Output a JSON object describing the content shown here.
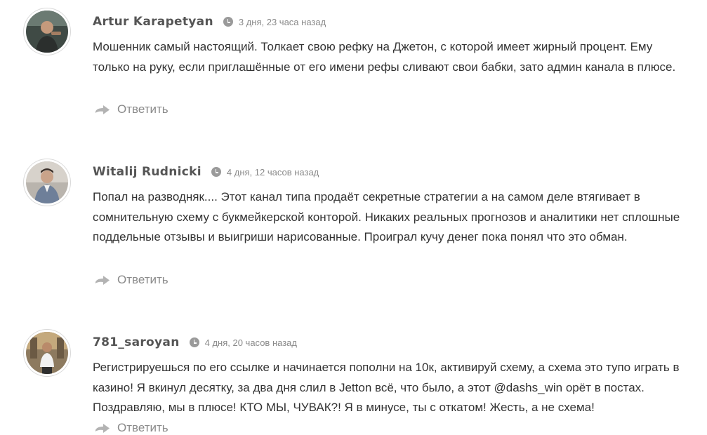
{
  "comments": [
    {
      "author": "Artur Karapetyan",
      "time": "3 дня, 23 часа назад",
      "text": "Мошенник самый настоящий. Толкает свою рефку на Джетон, с которой имеет жирный процент. Ему только на руку, если приглашённые от его имени рефы сливают свои бабки, зато админ канала в плюсе.",
      "reply": "Ответить"
    },
    {
      "author": "Witalij Rudnicki",
      "time": "4 дня, 12 часов назад",
      "text": "Попал на разводняк.... Этот канал типа продаёт секретные стратегии а на самом деле втягивает в сомнительную схему с букмейкерской конторой. Никаких реальных прогнозов и аналитики нет сплошные поддельные отзывы и выигриши нарисованные. Проиграл кучу денег пока понял что это обман.",
      "reply": "Ответить"
    },
    {
      "author": "781_saroyan",
      "time": "4 дня, 20 часов назад",
      "text": "Регистрируешься по его ссылке и начинается пополни на 10к, активируй схему, а схема это тупо играть в казино! Я вкинул десятку, за два дня слил в Jetton всё, что было, а этот @dashs_win орёт в постах. Поздравляю, мы в плюсе! КТО МЫ, ЧУВАК?! Я в минусе, ты с откатом! Жесть, а не схема!",
      "reply": "Ответить"
    }
  ],
  "icons": {
    "time": "clock-icon",
    "reply": "reply-arrow-icon"
  },
  "colors": {
    "author": "#555555",
    "meta": "#8a8a8a",
    "text": "#333333",
    "reply": "#8a8a8a"
  }
}
